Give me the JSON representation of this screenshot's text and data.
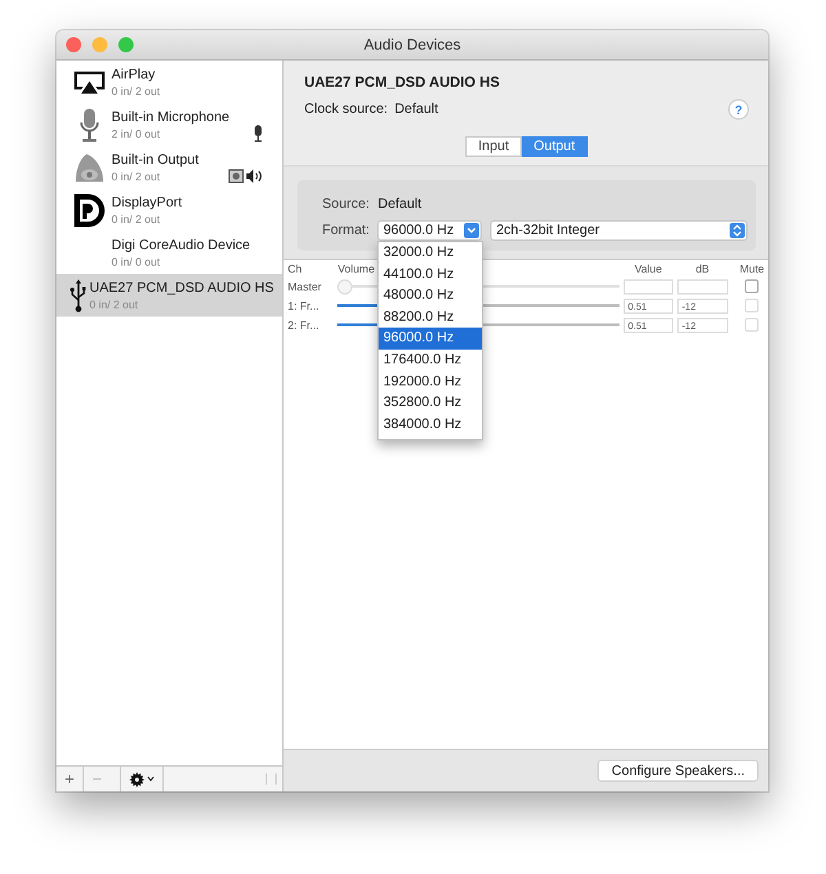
{
  "window": {
    "title": "Audio Devices"
  },
  "devices": [
    {
      "name": "AirPlay",
      "io": "0 in/ 2 out",
      "kind": "airplay",
      "selected": false
    },
    {
      "name": "Built-in Microphone",
      "io": "2 in/ 0 out",
      "kind": "microphone",
      "selected": false
    },
    {
      "name": "Built-in Output",
      "io": "0 in/ 2 out",
      "kind": "speaker",
      "selected": false
    },
    {
      "name": "DisplayPort",
      "io": "0 in/ 2 out",
      "kind": "displayport",
      "selected": false
    },
    {
      "name": "Digi CoreAudio Device",
      "io": "0 in/ 0 out",
      "kind": "none",
      "selected": false
    },
    {
      "name": "UAE27 PCM_DSD AUDIO HS",
      "io": "0 in/ 2 out",
      "kind": "usb",
      "selected": true
    }
  ],
  "sidebar_toolbar": {
    "add": "+",
    "remove": "−"
  },
  "device": {
    "name": "UAE27 PCM_DSD AUDIO HS",
    "clock_label": "Clock source:",
    "clock_value": "Default",
    "help": "?"
  },
  "tabs": [
    {
      "label": "Input",
      "selected": false
    },
    {
      "label": "Output",
      "selected": true
    }
  ],
  "source": {
    "label": "Source:",
    "value": "Default"
  },
  "format": {
    "label": "Format:",
    "rate": "96000.0 Hz",
    "channels": "2ch-32bit Integer"
  },
  "rate_menu": [
    {
      "label": "32000.0 Hz",
      "selected": false
    },
    {
      "label": "44100.0 Hz",
      "selected": false
    },
    {
      "label": "48000.0 Hz",
      "selected": false
    },
    {
      "label": "88200.0 Hz",
      "selected": false
    },
    {
      "label": "96000.0 Hz",
      "selected": true
    },
    {
      "label": "176400.0 Hz",
      "selected": false
    },
    {
      "label": "192000.0 Hz",
      "selected": false
    },
    {
      "label": "352800.0 Hz",
      "selected": false
    },
    {
      "label": "384000.0 Hz",
      "selected": false
    }
  ],
  "table": {
    "columns": [
      "Ch",
      "Volume",
      "Value",
      "dB",
      "Mute"
    ],
    "rows": [
      {
        "ch": "Master",
        "level": 0,
        "slider_enabled": false,
        "mute_disabled": false,
        "muted": false
      },
      {
        "ch": "1: Fr...",
        "level": 0.51,
        "value": "0.51",
        "db": "-12",
        "slider_enabled": true,
        "mute_disabled": true,
        "muted": false
      },
      {
        "ch": "2: Fr...",
        "level": 0.51,
        "value": "0.51",
        "db": "-12",
        "slider_enabled": true,
        "mute_disabled": true,
        "muted": false
      }
    ]
  },
  "configure_button": "Configure Speakers..."
}
